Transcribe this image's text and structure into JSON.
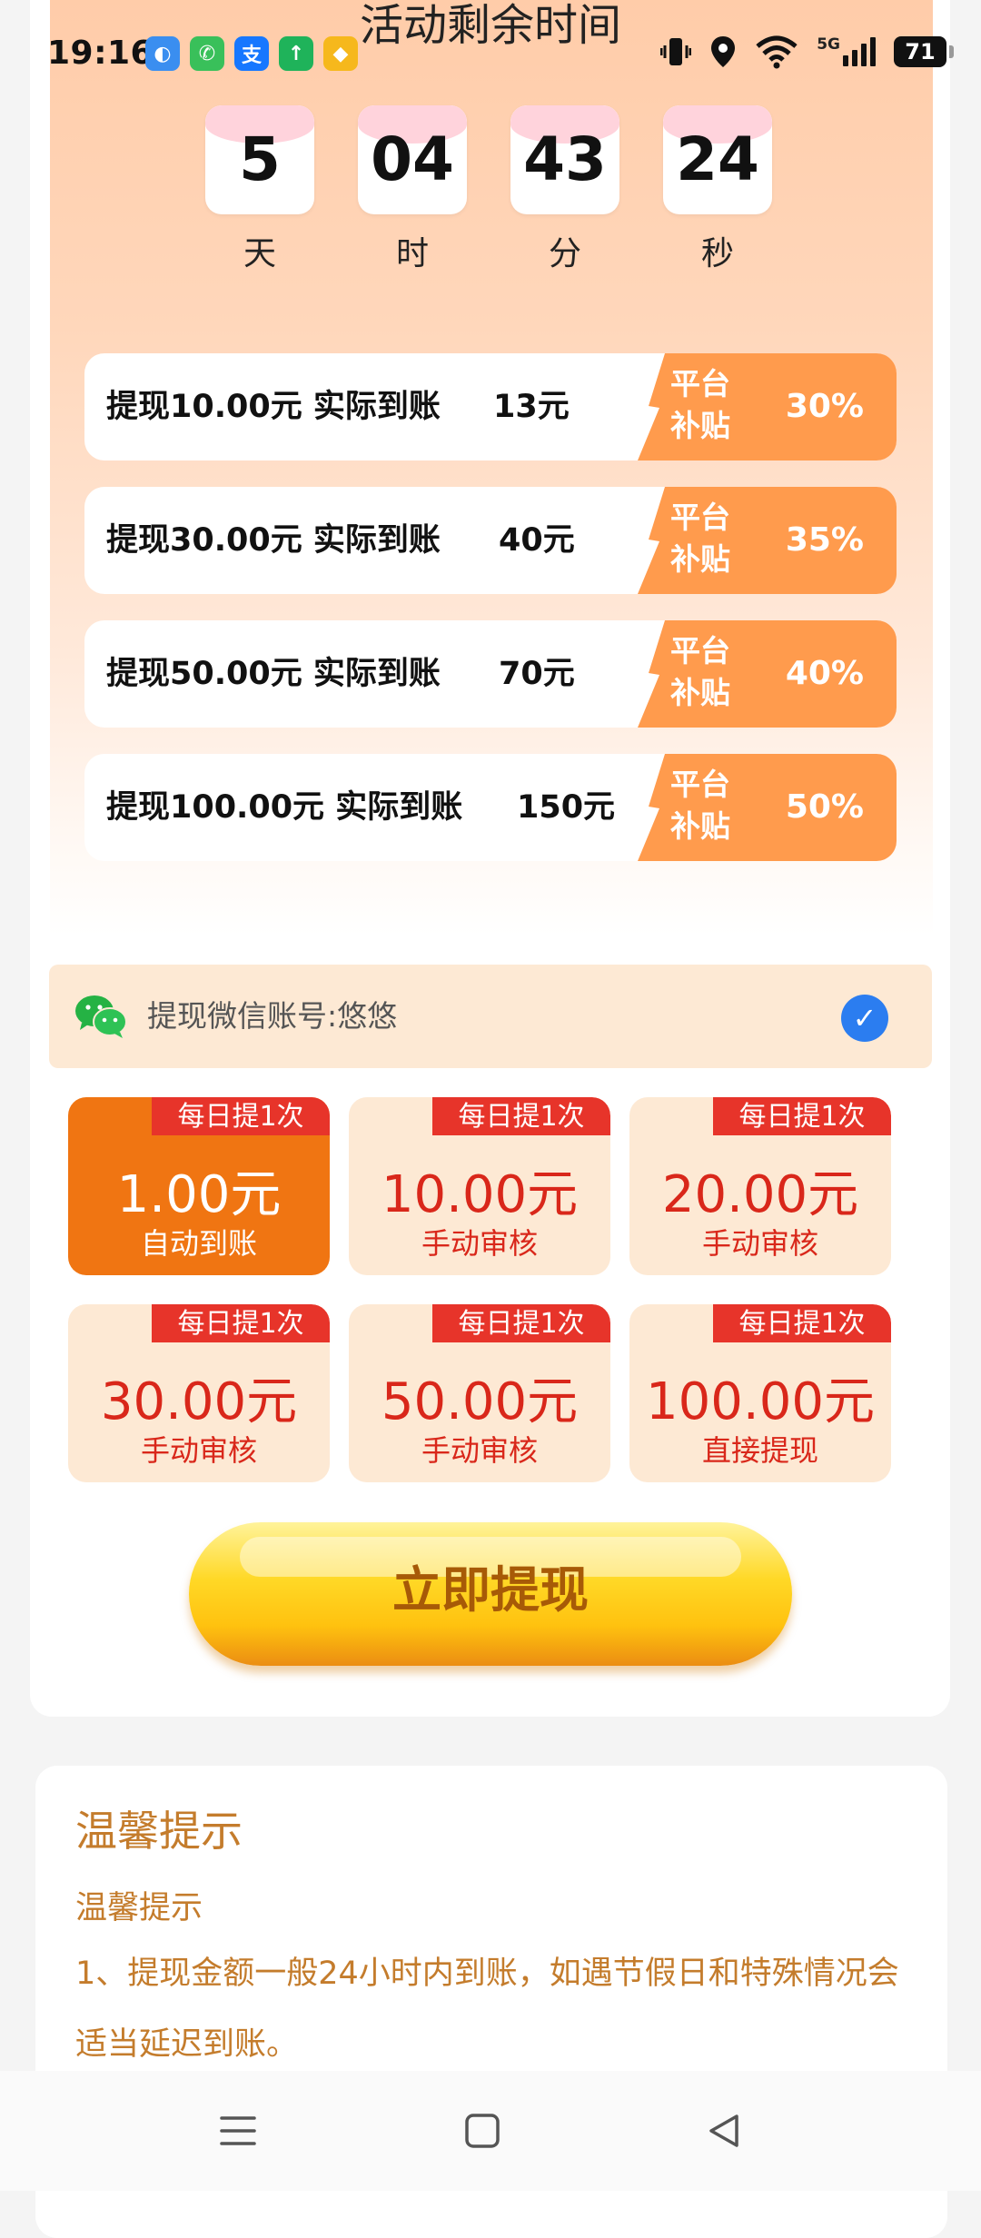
{
  "status_bar": {
    "time": "19:16",
    "app_icons": [
      {
        "name": "browser-app-icon",
        "glyph": "◐",
        "color": "#3a8ef0"
      },
      {
        "name": "phone-app-icon",
        "glyph": "✆",
        "color": "#39c05a"
      },
      {
        "name": "alipay-app-icon",
        "glyph": "支",
        "color": "#1677ff"
      },
      {
        "name": "upload-app-icon",
        "glyph": "↑",
        "color": "#1fb35a"
      },
      {
        "name": "coin-app-icon",
        "glyph": "◆",
        "color": "#f6b81c"
      }
    ],
    "network": "5G",
    "battery": "71"
  },
  "activity": {
    "title": "活动剩余时间",
    "countdown": [
      {
        "value": "5",
        "unit": "天"
      },
      {
        "value": "04",
        "unit": "时"
      },
      {
        "value": "43",
        "unit": "分"
      },
      {
        "value": "24",
        "unit": "秒"
      }
    ],
    "offers": [
      {
        "withdraw": "提现10.00元 实际到账",
        "actual": "13元",
        "tag": "平台补贴",
        "rate": "30%"
      },
      {
        "withdraw": "提现30.00元 实际到账",
        "actual": "40元",
        "tag": "平台补贴",
        "rate": "35%"
      },
      {
        "withdraw": "提现50.00元 实际到账",
        "actual": "70元",
        "tag": "平台补贴",
        "rate": "40%"
      },
      {
        "withdraw": "提现100.00元 实际到账",
        "actual": "150元",
        "tag": "平台补贴",
        "rate": "50%"
      }
    ]
  },
  "wechat": {
    "label": "提现微信账号:悠悠",
    "check": "✓"
  },
  "amounts": [
    {
      "tag": "每日提1次",
      "value": "1.00元",
      "sub": "自动到账",
      "selected": true
    },
    {
      "tag": "每日提1次",
      "value": "10.00元",
      "sub": "手动审核",
      "selected": false
    },
    {
      "tag": "每日提1次",
      "value": "20.00元",
      "sub": "手动审核",
      "selected": false
    },
    {
      "tag": "每日提1次",
      "value": "30.00元",
      "sub": "手动审核",
      "selected": false
    },
    {
      "tag": "每日提1次",
      "value": "50.00元",
      "sub": "手动审核",
      "selected": false
    },
    {
      "tag": "每日提1次",
      "value": "100.00元",
      "sub": "直接提现",
      "selected": false
    }
  ],
  "withdraw_button": "立即提现",
  "tips": {
    "title": "温馨提示",
    "subtitle": "温馨提示",
    "line1": "1、提现金额一般24小时内到账，如遇节假日和特殊情况会适当延迟到账。"
  },
  "colors": {
    "accent_orange": "#f07512",
    "tag_red": "#e7342a",
    "subsidy_orange": "#ff9b4d",
    "tips_brown": "#c47c2c"
  }
}
